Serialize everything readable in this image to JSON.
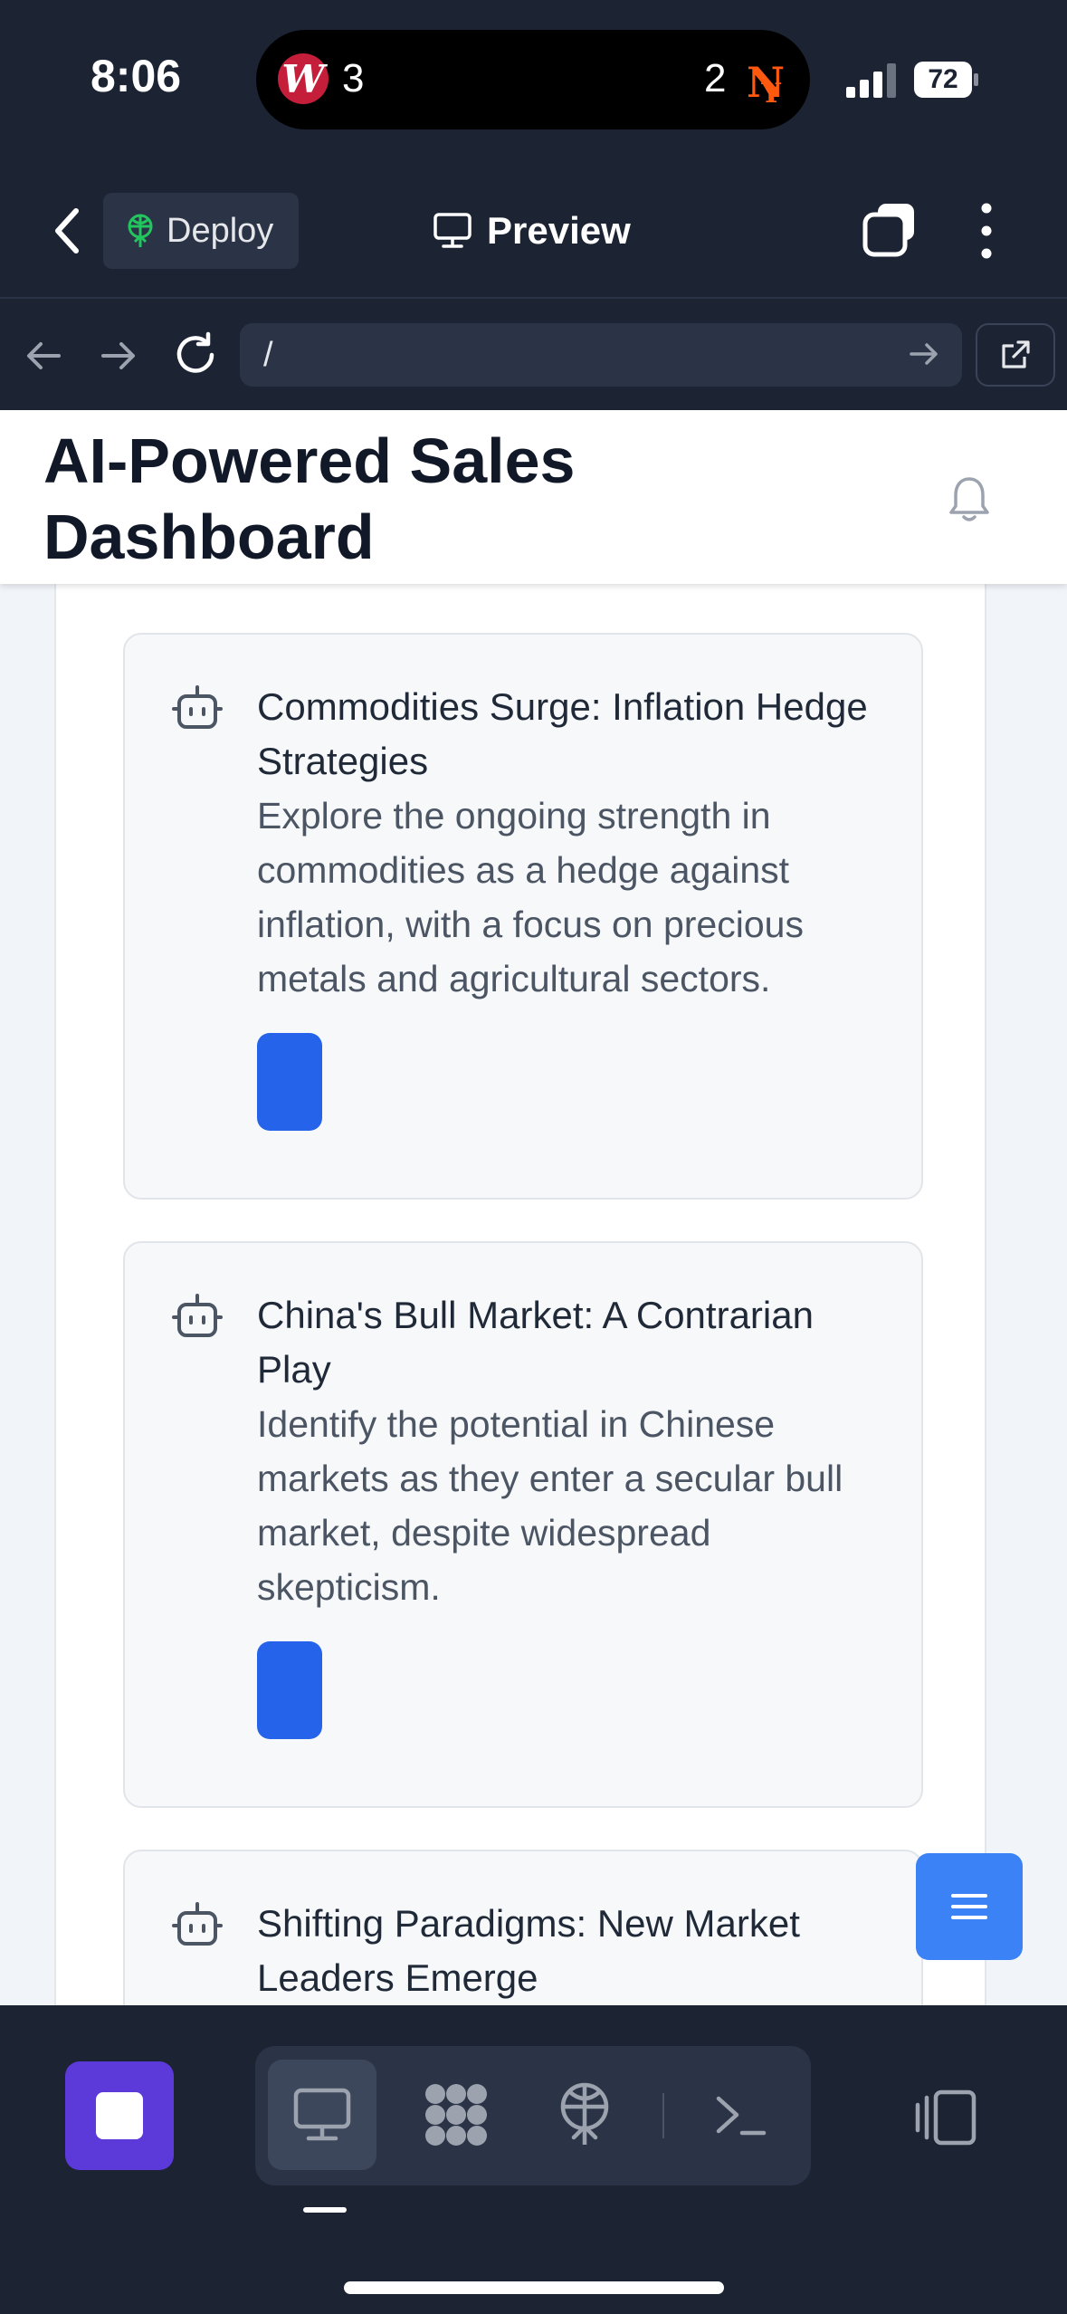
{
  "status_bar": {
    "time": "8:06",
    "game": {
      "home_score": "3",
      "away_score": "2",
      "home_team_logo": "W",
      "away_team_logo": "NY"
    },
    "battery": "72"
  },
  "toolbar": {
    "deploy_label": "Deploy",
    "preview_label": "Preview"
  },
  "urlbar": {
    "url": "/"
  },
  "page": {
    "title": "AI-Powered Sales Dashboard",
    "cards": [
      {
        "title": "Commodities Surge: Inflation Hedge Strategies",
        "description": "Explore the ongoing strength in commodities as a hedge against inflation, with a focus on precious metals and agricultural sectors.",
        "icon": "robot-icon"
      },
      {
        "title": "China's Bull Market: A Contrarian Play",
        "description": "Identify the potential in Chinese markets as they enter a secular bull market, despite widespread skepticism.",
        "icon": "robot-icon"
      },
      {
        "title": "Shifting Paradigms: New Market Leaders Emerge",
        "description": "",
        "icon": "robot-icon"
      }
    ]
  },
  "colors": {
    "accent": "#2563eb",
    "fab": "#3b82f6",
    "stop": "#5b3ad9",
    "chrome": "#1c2333"
  }
}
